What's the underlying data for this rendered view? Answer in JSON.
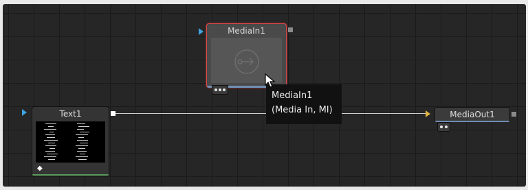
{
  "nodes": {
    "media_in": {
      "title": "MediaIn1"
    },
    "text": {
      "title": "Text1"
    },
    "media_out": {
      "title": "MediaOut1"
    }
  },
  "tooltip": {
    "line1": "MediaIn1",
    "line2": "(Media In, MI)"
  },
  "colors": {
    "canvas": "#262626",
    "selected_border": "#d44a4a",
    "input_port_blue": "#3fa3e0",
    "input_port_yellow": "#e0b33f",
    "output_bar_blue": "#6f8fb5",
    "text_bar_green": "#5a9a5a"
  },
  "icons": [
    "media-in-arrow-icon",
    "keyframe-diamond-icon",
    "cursor-arrow-icon"
  ]
}
